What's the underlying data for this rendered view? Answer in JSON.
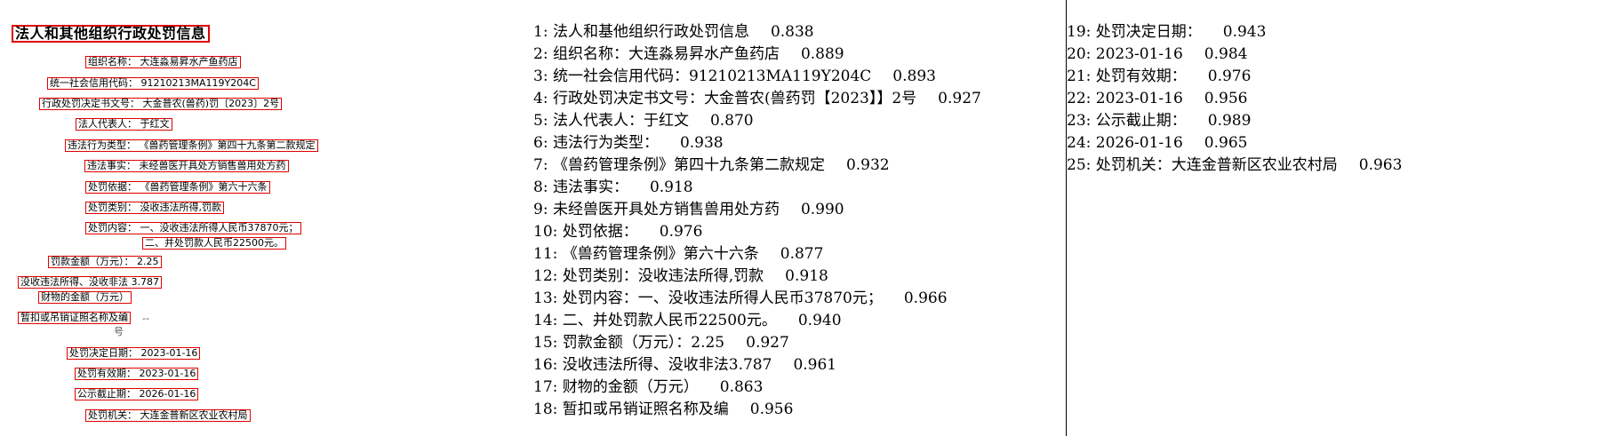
{
  "document": {
    "title": "法人和其他组织行政处罚信息",
    "fields": [
      "组织名称： 大连淼易昇水产鱼药店",
      "统一社会信用代码： 91210213MA119Y204C",
      "行政处罚决定书文号： 大金普农(兽药)罚〔2023〕2号",
      "法人代表人： 于红文",
      "违法行为类型： 《兽药管理条例》第四十九条第二款规定",
      "违法事实： 未经兽医开具处方销售兽用处方药",
      "处罚依据： 《兽药管理条例》第六十六条",
      "处罚类别： 没收违法所得,罚款",
      "处罚内容： 一、没收违法所得人民币37870元；",
      "二、并处罚款人民币22500元。",
      "罚款金额（万元）： 2.25",
      "没收违法所得、没收非法 3.787",
      "财物的金额（万元）",
      "暂扣或吊销证照名称及编",
      "号",
      "--",
      "处罚决定日期： 2023-01-16",
      "处罚有效期： 2023-01-16",
      "公示截止期： 2026-01-16",
      "处罚机关： 大连金普新区农业农村局"
    ]
  },
  "ocr_results": [
    {
      "index": "1:",
      "text": "法人和基他组织行政处罚信息",
      "score": "0.838"
    },
    {
      "index": "2:",
      "text": "组织名称：大连淼易昇水产鱼药店",
      "score": "0.889"
    },
    {
      "index": "3:",
      "text": "统一社会信用代码：91210213MA119Y204C",
      "score": "0.893"
    },
    {
      "index": "4:",
      "text": "行政处罚决定书文号：大金普农(兽药罚【2023】】2号",
      "score": "0.927"
    },
    {
      "index": "5:",
      "text": "法人代表人：于红文",
      "score": "0.870"
    },
    {
      "index": "6:",
      "text": "违法行为类型：",
      "score": "0.938"
    },
    {
      "index": "7:",
      "text": "《兽药管理条例》第四十九条第二款规定",
      "score": "0.932"
    },
    {
      "index": "8:",
      "text": "违法事实：",
      "score": "0.918"
    },
    {
      "index": "9:",
      "text": "未经兽医开具处方销售兽用处方药",
      "score": "0.990"
    },
    {
      "index": "10:",
      "text": "处罚依据：",
      "score": "0.976"
    },
    {
      "index": "11:",
      "text": "《兽药管理条例》第六十六条",
      "score": "0.877"
    },
    {
      "index": "12:",
      "text": "处罚类别：没收违法所得,罚款",
      "score": "0.918"
    },
    {
      "index": "13:",
      "text": "处罚内容：一、没收违法所得人民币37870元；",
      "score": "0.966"
    },
    {
      "index": "14:",
      "text": "二、并处罚款人民币22500元。",
      "score": "0.940"
    },
    {
      "index": "15:",
      "text": "罚款金额（万元）：2.25",
      "score": "0.927"
    },
    {
      "index": "16:",
      "text": "没收违法所得、没收非法3.787",
      "score": "0.961"
    },
    {
      "index": "17:",
      "text": "财物的金额（万元）",
      "score": "0.863"
    },
    {
      "index": "18:",
      "text": "暂扣或吊销证照名称及编",
      "score": "0.956"
    },
    {
      "index": "19:",
      "text": "处罚决定日期：",
      "score": "0.943"
    },
    {
      "index": "20:",
      "text": "2023-01-16",
      "score": "0.984"
    },
    {
      "index": "21:",
      "text": "处罚有效期：",
      "score": "0.976"
    },
    {
      "index": "22:",
      "text": "2023-01-16",
      "score": "0.956"
    },
    {
      "index": "23:",
      "text": "公示截止期：",
      "score": "0.989"
    },
    {
      "index": "24:",
      "text": "2026-01-16",
      "score": "0.965"
    },
    {
      "index": "25:",
      "text": "处罚机关：大连金普新区农业农村局",
      "score": "0.963"
    }
  ]
}
